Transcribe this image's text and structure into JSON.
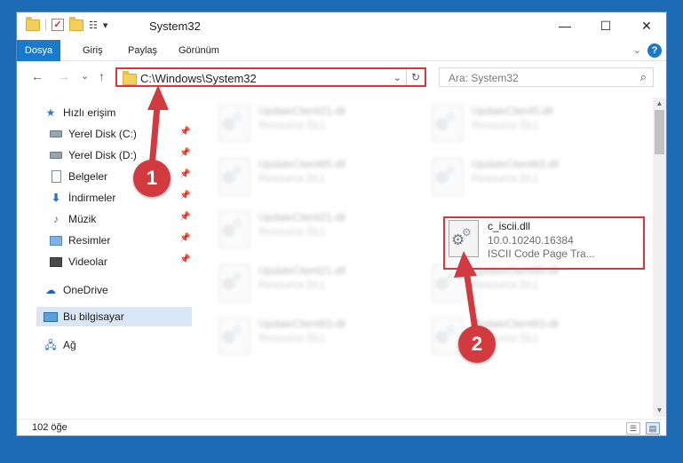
{
  "window": {
    "title": "System32",
    "qa_caret": "▾",
    "controls": {
      "minimize": "—",
      "maximize": "☐",
      "close": "✕"
    }
  },
  "ribbon": {
    "tabs": [
      "Dosya",
      "Giriş",
      "Paylaş",
      "Görünüm"
    ],
    "help": "?"
  },
  "navbar": {
    "back": "←",
    "forward": "→",
    "recent": "⌄",
    "up": "↑",
    "address": "C:\\Windows\\System32",
    "search_placeholder": "Ara: System32"
  },
  "sidebar": {
    "quick_access": "Hızlı erişim",
    "items": [
      {
        "label": "Yerel Disk (C:)",
        "icon": "disk-icon"
      },
      {
        "label": "Yerel Disk (D:)",
        "icon": "disk-icon"
      },
      {
        "label": "Belgeler",
        "icon": "documents-icon"
      },
      {
        "label": "İndirmeler",
        "icon": "downloads-icon"
      },
      {
        "label": "Müzik",
        "icon": "music-icon"
      },
      {
        "label": "Resimler",
        "icon": "pictures-icon"
      },
      {
        "label": "Videolar",
        "icon": "videos-icon"
      }
    ],
    "onedrive": "OneDrive",
    "this_pc": "Bu bilgisayar",
    "network": "Ağ"
  },
  "files": [
    {
      "name": "UpdateClient21.dll",
      "type": "Resource DLL"
    },
    {
      "name": "UpdateClient5.dll",
      "type": "Resource DLL"
    },
    {
      "name": "UpdateClient65.dll",
      "type": "Resource DLL"
    },
    {
      "name": "UpdateClient63.dll",
      "type": "Resource DLL"
    },
    {
      "name": "UpdateClient21.dll",
      "type": "Resource DLL"
    },
    {
      "name": "c_iscii.dll",
      "version": "10.0.10240.16384",
      "description": "ISCII Code Page Tra..."
    },
    {
      "name": "UpdateClient21.dll",
      "type": "Resource DLL"
    },
    {
      "name": "UpdateClient65.dll",
      "type": "Resource DLL"
    },
    {
      "name": "UpdateClient63.dll",
      "type": "Resource DLL"
    },
    {
      "name": "UpdateClient63.dll",
      "type": "Resource DLL"
    }
  ],
  "status": {
    "count": "102 öğe"
  },
  "annotations": {
    "marker1": "1",
    "marker2": "2",
    "color": "#d33a3f"
  }
}
